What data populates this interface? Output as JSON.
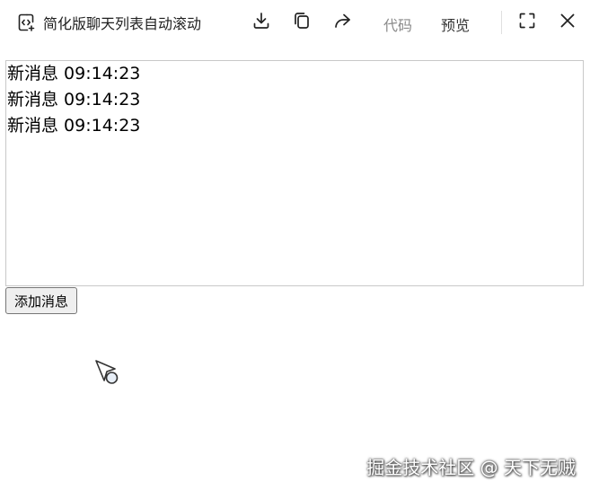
{
  "toolbar": {
    "title": "简化版聊天列表自动滚动",
    "icons": {
      "app": "code-file-icon",
      "download": "download-icon",
      "copy": "copy-icon",
      "share": "share-icon",
      "fullscreen": "fullscreen-icon",
      "close": "close-icon"
    },
    "tab_code": "代码",
    "tab_preview": "预览"
  },
  "chat": {
    "messages": [
      "新消息 09:14:23",
      "新消息 09:14:23",
      "新消息 09:14:23"
    ]
  },
  "add_button_label": "添加消息",
  "watermark": "掘金技术社区 @ 天下无贼"
}
